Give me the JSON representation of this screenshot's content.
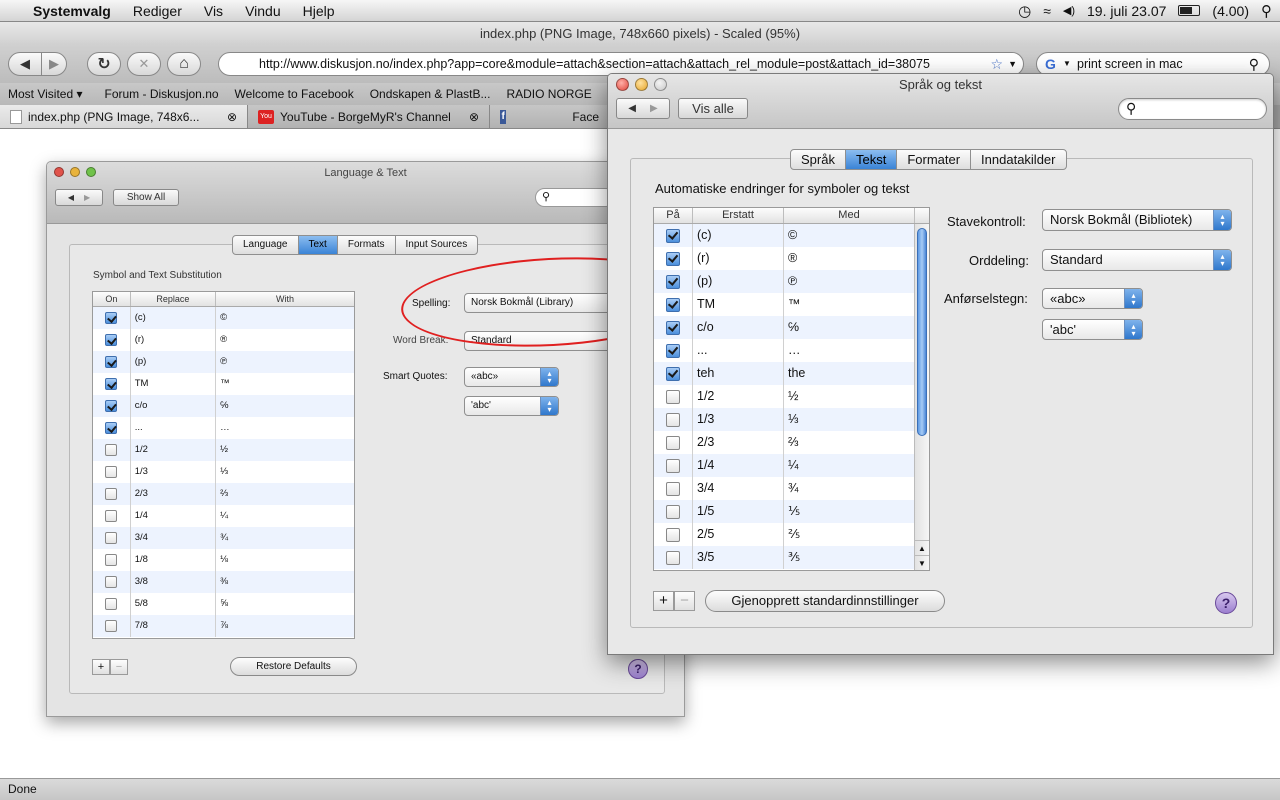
{
  "menubar": {
    "app_name": "Systemvalg",
    "menus": [
      "Rediger",
      "Vis",
      "Vindu",
      "Hjelp"
    ],
    "clock": "19. juli 23.07",
    "battery": "(4.00)"
  },
  "browser": {
    "window_title": "index.php (PNG Image, 748x660 pixels) - Scaled (95%)",
    "url": "http://www.diskusjon.no/index.php?app=core&module=attach&section=attach&attach_rel_module=post&attach_id=38075",
    "search_value": "print screen in mac",
    "bookmarks": [
      "Most Visited ▾",
      "Forum - Diskusjon.no",
      "Welcome to Facebook",
      "Ondskapen & PlastB...",
      "RADIO NORGE"
    ],
    "tabs": [
      "index.php (PNG Image, 748x6...",
      "YouTube - BorgeMyR's Channel",
      "Face"
    ],
    "status": "Done"
  },
  "bg_window": {
    "title": "Language & Text",
    "show_all": "Show All",
    "segments": [
      "Language",
      "Text",
      "Formats",
      "Input Sources"
    ],
    "section_title": "Symbol and Text Substitution",
    "columns": [
      "On",
      "Replace",
      "With"
    ],
    "rows": [
      {
        "on": true,
        "replace": "(c)",
        "with": "©"
      },
      {
        "on": true,
        "replace": "(r)",
        "with": "®"
      },
      {
        "on": true,
        "replace": "(p)",
        "with": "℗"
      },
      {
        "on": true,
        "replace": "TM",
        "with": "™"
      },
      {
        "on": true,
        "replace": "c/o",
        "with": "℅"
      },
      {
        "on": true,
        "replace": "...",
        "with": "…"
      },
      {
        "on": false,
        "replace": "1/2",
        "with": "½"
      },
      {
        "on": false,
        "replace": "1/3",
        "with": "⅓"
      },
      {
        "on": false,
        "replace": "2/3",
        "with": "⅔"
      },
      {
        "on": false,
        "replace": "1/4",
        "with": "¼"
      },
      {
        "on": false,
        "replace": "3/4",
        "with": "¾"
      },
      {
        "on": false,
        "replace": "1/8",
        "with": "⅛"
      },
      {
        "on": false,
        "replace": "3/8",
        "with": "⅜"
      },
      {
        "on": false,
        "replace": "5/8",
        "with": "⅝"
      },
      {
        "on": false,
        "replace": "7/8",
        "with": "⅞"
      }
    ],
    "spelling_label": "Spelling:",
    "spelling_value": "Norsk Bokmål (Library)",
    "wordbreak_label": "Word Break:",
    "wordbreak_value": "Standard",
    "smartquotes_label": "Smart Quotes:",
    "double_quote": "«abc»",
    "single_quote": "'abc'",
    "restore": "Restore Defaults"
  },
  "fg_window": {
    "title": "Språk og tekst",
    "show_all": "Vis alle",
    "segments": [
      "Språk",
      "Tekst",
      "Formater",
      "Inndatakilder"
    ],
    "section_title": "Automatiske endringer for symboler og tekst",
    "columns": [
      "På",
      "Erstatt",
      "Med"
    ],
    "rows": [
      {
        "on": true,
        "replace": "(c)",
        "with": "©"
      },
      {
        "on": true,
        "replace": "(r)",
        "with": "®"
      },
      {
        "on": true,
        "replace": "(p)",
        "with": "℗"
      },
      {
        "on": true,
        "replace": "TM",
        "with": "™"
      },
      {
        "on": true,
        "replace": "c/o",
        "with": "℅"
      },
      {
        "on": true,
        "replace": "...",
        "with": "…"
      },
      {
        "on": true,
        "replace": "teh",
        "with": "the"
      },
      {
        "on": false,
        "replace": "1/2",
        "with": "½"
      },
      {
        "on": false,
        "replace": "1/3",
        "with": "⅓"
      },
      {
        "on": false,
        "replace": "2/3",
        "with": "⅔"
      },
      {
        "on": false,
        "replace": "1/4",
        "with": "¼"
      },
      {
        "on": false,
        "replace": "3/4",
        "with": "¾"
      },
      {
        "on": false,
        "replace": "1/5",
        "with": "⅕"
      },
      {
        "on": false,
        "replace": "2/5",
        "with": "⅖"
      },
      {
        "on": false,
        "replace": "3/5",
        "with": "⅗"
      }
    ],
    "spelling_label": "Stavekontroll:",
    "spelling_value": "Norsk Bokmål (Bibliotek)",
    "wordbreak_label": "Orddeling:",
    "wordbreak_value": "Standard",
    "quotes_label": "Anførselstegn:",
    "double_quote": "«abc»",
    "single_quote": "'abc'",
    "restore": "Gjenopprett standardinnstillinger"
  },
  "icons": {
    "apple": "",
    "back": "◀",
    "forward": "▶",
    "reload": "↻",
    "stop": "✕",
    "home": "⌂",
    "star": "☆",
    "dropdown": "▼",
    "search": "⚲",
    "close_tab": "⊗",
    "add": "+",
    "remove": "−",
    "help": "?",
    "scroll_up": "▲",
    "scroll_down": "▼",
    "arrow_up": "▴",
    "arrow_down": "▾",
    "clock": "◷",
    "wifi": "◠",
    "volume": "◀)"
  },
  "colors": {
    "selected_segment": "#3a83d6",
    "annotation_oval": "#e02020",
    "help_button": "#9b7fcf"
  }
}
